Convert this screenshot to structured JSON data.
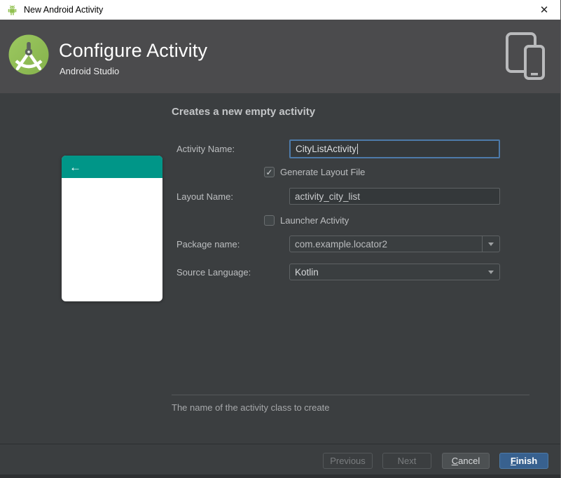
{
  "window": {
    "title": "New Android Activity",
    "close_glyph": "✕"
  },
  "header": {
    "title": "Configure Activity",
    "subtitle": "Android Studio"
  },
  "preview": {
    "back_arrow": "←"
  },
  "main": {
    "heading": "Creates a new empty activity",
    "form": {
      "activity_name": {
        "label": "Activity Name:",
        "value": "CityListActivity"
      },
      "generate_layout": {
        "label": "Generate Layout File",
        "checked": true,
        "check_glyph": "✓"
      },
      "layout_name": {
        "label": "Layout Name:",
        "value": "activity_city_list"
      },
      "launcher_activity": {
        "label": "Launcher Activity",
        "checked": false
      },
      "package_name": {
        "label": "Package name:",
        "value": "com.example.locator2"
      },
      "source_language": {
        "label": "Source Language:",
        "value": "Kotlin"
      }
    },
    "hint": "The name of the activity class to create"
  },
  "footer": {
    "previous": {
      "label": "Previous",
      "enabled": false
    },
    "next": {
      "label": "Next",
      "enabled": false
    },
    "cancel": {
      "mnemonic": "C",
      "rest": "ancel",
      "enabled": true
    },
    "finish": {
      "mnemonic": "F",
      "rest": "inish",
      "enabled": true,
      "default": true
    }
  },
  "colors": {
    "titlebar_bg": "#ffffff",
    "header_bg": "#4b4b4d",
    "body_bg": "#3b3e40",
    "accent_teal": "#009688",
    "focus_border": "#4d7aa9",
    "finish_button_bg": "#38618f",
    "android_green": "#91c150"
  }
}
